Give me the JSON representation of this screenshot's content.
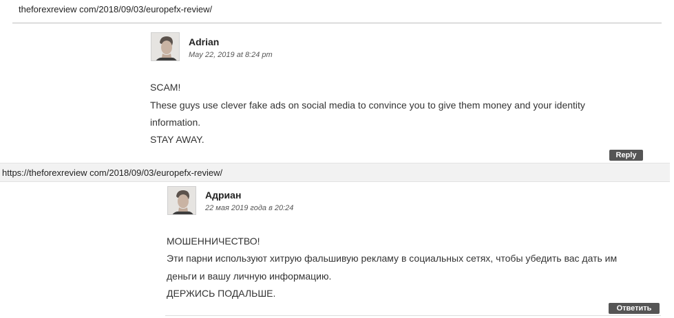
{
  "top_url": "theforexreview com/2018/09/03/europefx-review/",
  "comment_en": {
    "author": "Adrian",
    "date": "May 22, 2019 at 8:24 pm",
    "lines": [
      "SCAM!",
      "These guys use clever fake ads on social media to convince you to give them money and your identity",
      "information.",
      "STAY AWAY."
    ],
    "reply_label": "Reply"
  },
  "status_url": "https://theforexreview com/2018/09/03/europefx-review/",
  "comment_ru": {
    "author": "Адриан",
    "date": "22 мая 2019 года в 20:24",
    "lines": [
      "МОШЕННИЧЕСТВО!",
      "Эти парни используют хитрую фальшивую рекламу в социальных сетях, чтобы убедить вас дать им",
      "деньги и вашу личную информацию.",
      "ДЕРЖИСЬ ПОДАЛЬШЕ."
    ],
    "reply_label": "Ответить"
  }
}
